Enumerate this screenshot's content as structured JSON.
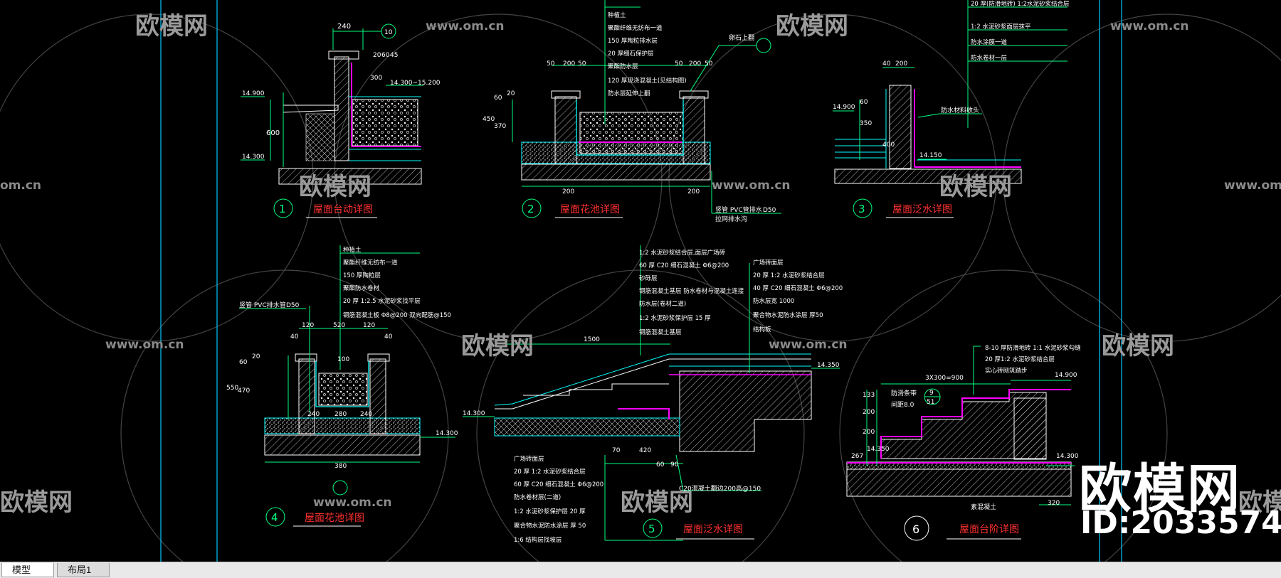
{
  "tabs": [
    {
      "label": "模型",
      "active": true
    },
    {
      "label": "布局1",
      "active": false
    }
  ],
  "colors": {
    "background": "#000000",
    "cyan": "#00ffff",
    "magenta": "#ff00ff",
    "red": "#ff3030",
    "white": "#ffffff",
    "green": "#20e020"
  },
  "watermark": {
    "text": "欧模网",
    "url": "www.om.cn",
    "url_short": "om.cn",
    "id": "ID:2033574"
  },
  "details": [
    {
      "number": "1",
      "title": "屋面台动详图"
    },
    {
      "number": "2",
      "title": "屋面花池详图"
    },
    {
      "number": "3",
      "title": "屋面泛水详图"
    },
    {
      "number": "4",
      "title": "屋面花池详图"
    },
    {
      "number": "5",
      "title": "屋面泛水详图"
    },
    {
      "number": "6",
      "title": "屋面台阶详图"
    }
  ],
  "dims": {
    "d1": {
      "top": "240",
      "left": "600",
      "elev_top": "14.900",
      "elev_bottom": "14.300",
      "right_elev": "14.300~15.200",
      "v300": "300",
      "v20": "20",
      "v60": "60",
      "v45": "45"
    },
    "d2": {
      "top": [
        "50",
        "200",
        "50",
        "50",
        "200",
        "50"
      ],
      "left": [
        "450",
        "370",
        "60",
        "20"
      ],
      "bottom": [
        "200",
        "200"
      ],
      "note": "竖管  PVC管排水",
      "note_val": "D50",
      "note2": "拉网排水沟"
    },
    "d3": {
      "top": [
        "40",
        "200"
      ],
      "left": [
        "60",
        "350",
        "400"
      ],
      "elev_top": "14.900",
      "elev_bottom": "14.150"
    },
    "d4": {
      "top": [
        "40",
        "120",
        "520",
        "120",
        "40"
      ],
      "left": [
        "60",
        "20",
        "550",
        "470"
      ],
      "mid": [
        "240",
        "280",
        "240"
      ],
      "bottom": "380",
      "v100": "100",
      "elev": "14.300",
      "note": "竖管  PVC排水管",
      "note_val": "D50"
    },
    "d5": {
      "top": "1500",
      "bottom": [
        "70",
        "420",
        "60",
        "90"
      ],
      "elev_left": "14.300",
      "elev_right": "14.350",
      "bottom_note": "C20混凝土翻边200高@150"
    },
    "d6": {
      "stairs": "3X300=900",
      "left": [
        "133",
        "200",
        "200",
        "267"
      ],
      "elev_top": "14.900",
      "elev_right": "14.300",
      "elev_left": "14.350",
      "note1": "防滑条带",
      "note2": "间距8.0",
      "detail_ref": "9",
      "detail_ref2": "51",
      "bottom_dim": "320",
      "bottom_note": "素混凝土"
    }
  },
  "notes": {
    "n1_leader": "10",
    "n2_right": [
      "种植土",
      "聚酯纤维无纺布一道",
      "150  厚陶粒排水层",
      "20  厚细石保护层",
      "聚酯防水层",
      "120  厚现浇混凝土(见结构图)",
      "防水层延伸上翻"
    ],
    "n2_label": "卵石上翻",
    "n3_right": [
      "20  厚(防滑地砖)  1:2水泥砂浆结合层",
      "1:2  水泥砂浆面层抹平",
      "防水涂膜一道",
      "防水卷材一层"
    ],
    "n3_label": "防水材料收头",
    "n4_right": [
      "种植土",
      "聚酯纤维无纺布一道",
      "150  厚陶粒层",
      "聚酯防水卷材",
      "20  厚  1:2.5  水泥砂浆找平层",
      "钢筋混凝土板  Φ8@200  双向配筋@150"
    ],
    "n5_top": [
      "1:2  水泥砂浆结合层,面层广场砖",
      "60  厚  C20  细石混凝土  Φ6@200",
      "砂砾层",
      "钢筋混凝土基层  防水卷材与混凝土连接",
      "防水层(卷材二道)",
      "1:2  水泥砂浆保护层  15  厚",
      "钢筋混凝土基层"
    ],
    "n5_right": [
      "广场砖面层",
      "20  厚  1:2  水泥砂浆结合层",
      "40  厚  C20  细石混凝土  Φ6@200",
      "防水层宽  1000",
      "聚合物水泥防水涂层  厚50",
      "结构板"
    ],
    "n5_bottom": [
      "广场砖面层",
      "20  厚  1:2  水泥砂浆结合层",
      "60  厚  C20  细石混凝土  Φ6@200",
      "防水卷材层(二道)",
      "1:2  水泥砂浆保护层  20  厚",
      "聚合物水泥防水涂层  厚  50",
      "1:6  结构层找坡层"
    ],
    "n6_right": [
      "8-10  厚防滑地砖  1:1  水泥砂浆勾缝",
      "20  厚1:2  水泥砂浆结合层",
      "实心砖砌筑踏步"
    ]
  }
}
